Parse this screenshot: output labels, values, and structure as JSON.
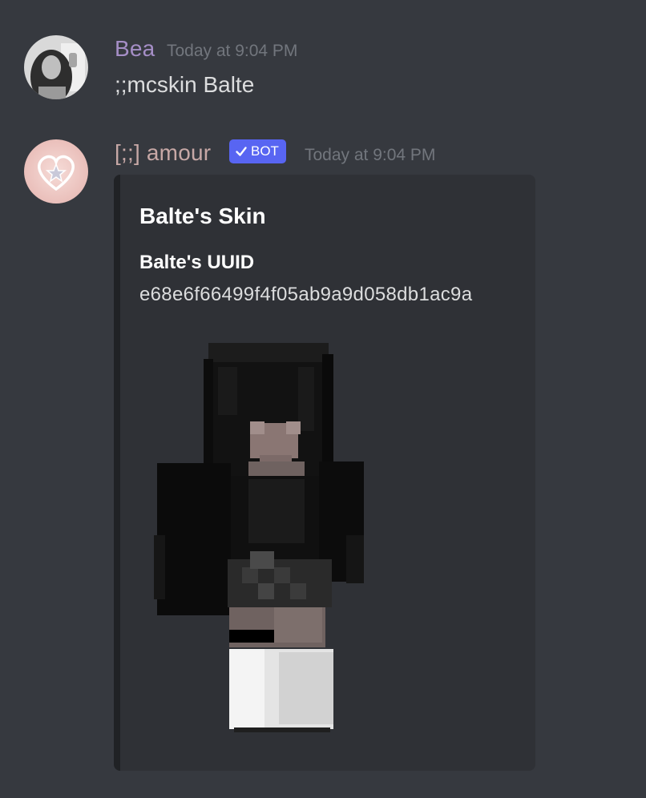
{
  "messages": [
    {
      "author": "Bea",
      "timestamp": "Today at 9:04 PM",
      "content": ";;mcskin Balte",
      "name_color": "#a58ec6"
    },
    {
      "author": "[;;] amour",
      "badge": "BOT",
      "badge_icon": "check-icon",
      "timestamp": "Today at 9:04 PM",
      "name_color": "#c7a8a6",
      "embed": {
        "title": "Balte's Skin",
        "field_name": "Balte's UUID",
        "field_value": "e68e6f66499f4f05ab9a9d058db1ac9a",
        "image": "minecraft-skin-render"
      }
    }
  ],
  "colors": {
    "background": "#36393f",
    "embed_background": "#2f3136",
    "bot_badge": "#5865f2",
    "timestamp": "#72767d"
  }
}
